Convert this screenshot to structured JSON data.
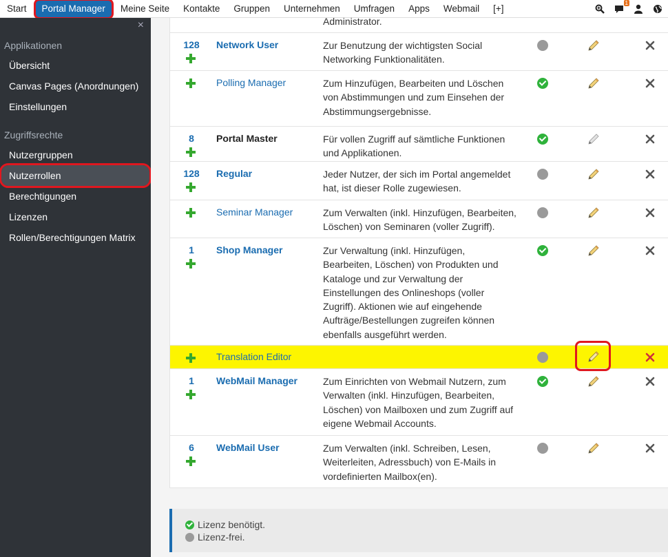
{
  "nav": {
    "items": [
      "Start",
      "Portal Manager",
      "Meine Seite",
      "Kontakte",
      "Gruppen",
      "Unternehmen",
      "Umfragen",
      "Apps",
      "Webmail",
      "[+]"
    ],
    "active_index": 1,
    "notification_count": "1",
    "icons": [
      "zoom-icon",
      "chat-icon",
      "user-icon",
      "globe-icon"
    ]
  },
  "sidebar": {
    "close": "×",
    "section1": "Applikationen",
    "apps": [
      "Übersicht",
      "Canvas Pages (Anordnungen)",
      "Einstellungen"
    ],
    "section2": "Zugriffsrechte",
    "access": [
      "Nutzergruppen",
      "Nutzerrollen",
      "Berechtigungen",
      "Lizenzen",
      "Rollen/Berechtigungen Matrix"
    ],
    "active": "Nutzerrollen"
  },
  "table": {
    "partial_top": "Administrator.",
    "rows": [
      {
        "count": "128",
        "name": "Network User",
        "bold": true,
        "desc": [
          "Zur Benutzung der wichtigsten Social",
          "Networking Funktionalitäten."
        ],
        "licensed": false
      },
      {
        "count": "",
        "name": "Polling Manager",
        "bold": false,
        "desc": [
          "Zum Hinzufügen, Bearbeiten und Löschen",
          "von Abstimmungen und zum Einsehen der",
          "Abstimmungsergebnisse."
        ],
        "licensed": true
      },
      {
        "count": "8",
        "name": "Portal Master",
        "bold": true,
        "dark": true,
        "desc": [
          "Für vollen Zugriff auf sämtliche Funktionen",
          "und Applikationen."
        ],
        "licensed": true
      },
      {
        "count": "128",
        "name": "Regular",
        "bold": true,
        "desc": [
          "Jeder Nutzer, der sich im Portal angemeldet",
          "hat, ist dieser Rolle zugewiesen."
        ],
        "licensed": false
      },
      {
        "count": "",
        "name": "Seminar Manager",
        "bold": false,
        "desc": [
          "Zum Verwalten (inkl. Hinzufügen, Bearbeiten,",
          "Löschen) von Seminaren (voller Zugriff)."
        ],
        "licensed": false
      },
      {
        "count": "1",
        "name": "Shop Manager",
        "bold": true,
        "desc": [
          "Zur Verwaltung (inkl. Hinzufügen,",
          "Bearbeiten, Löschen) von Produkten und",
          "Kataloge und zur Verwaltung der",
          "Einstellungen des Onlineshops (voller",
          "Zugriff). Aktionen wie auf eingehende",
          "Aufträge/Bestellungen zugreifen können",
          "ebenfalls ausgeführt werden."
        ],
        "licensed": true
      },
      {
        "count": "",
        "name": "Translation Editor",
        "bold": false,
        "desc": [],
        "licensed": false,
        "highlight": true
      },
      {
        "count": "1",
        "name": "WebMail Manager",
        "bold": true,
        "desc": [
          "Zum Einrichten von Webmail Nutzern, zum",
          "Verwalten (inkl. Hinzufügen, Bearbeiten,",
          "Löschen) von Mailboxen und zum Zugriff auf",
          "eigene Webmail Accounts."
        ],
        "licensed": true
      },
      {
        "count": "6",
        "name": "WebMail User",
        "bold": true,
        "desc": [
          "Zum Verwalten (inkl. Schreiben, Lesen,",
          "Weiterleiten, Adressbuch) von E-Mails in",
          "vordefinierten Mailbox(en)."
        ],
        "licensed": false
      }
    ]
  },
  "legend": {
    "licensed": "Lizenz benötigt.",
    "free": "Lizenz-frei."
  },
  "colors": {
    "accent": "#1a6cb0",
    "highlight": "#fdf500",
    "annotation": "#e0171f",
    "licensed": "#2fb23b",
    "free": "#9a9a9a"
  }
}
